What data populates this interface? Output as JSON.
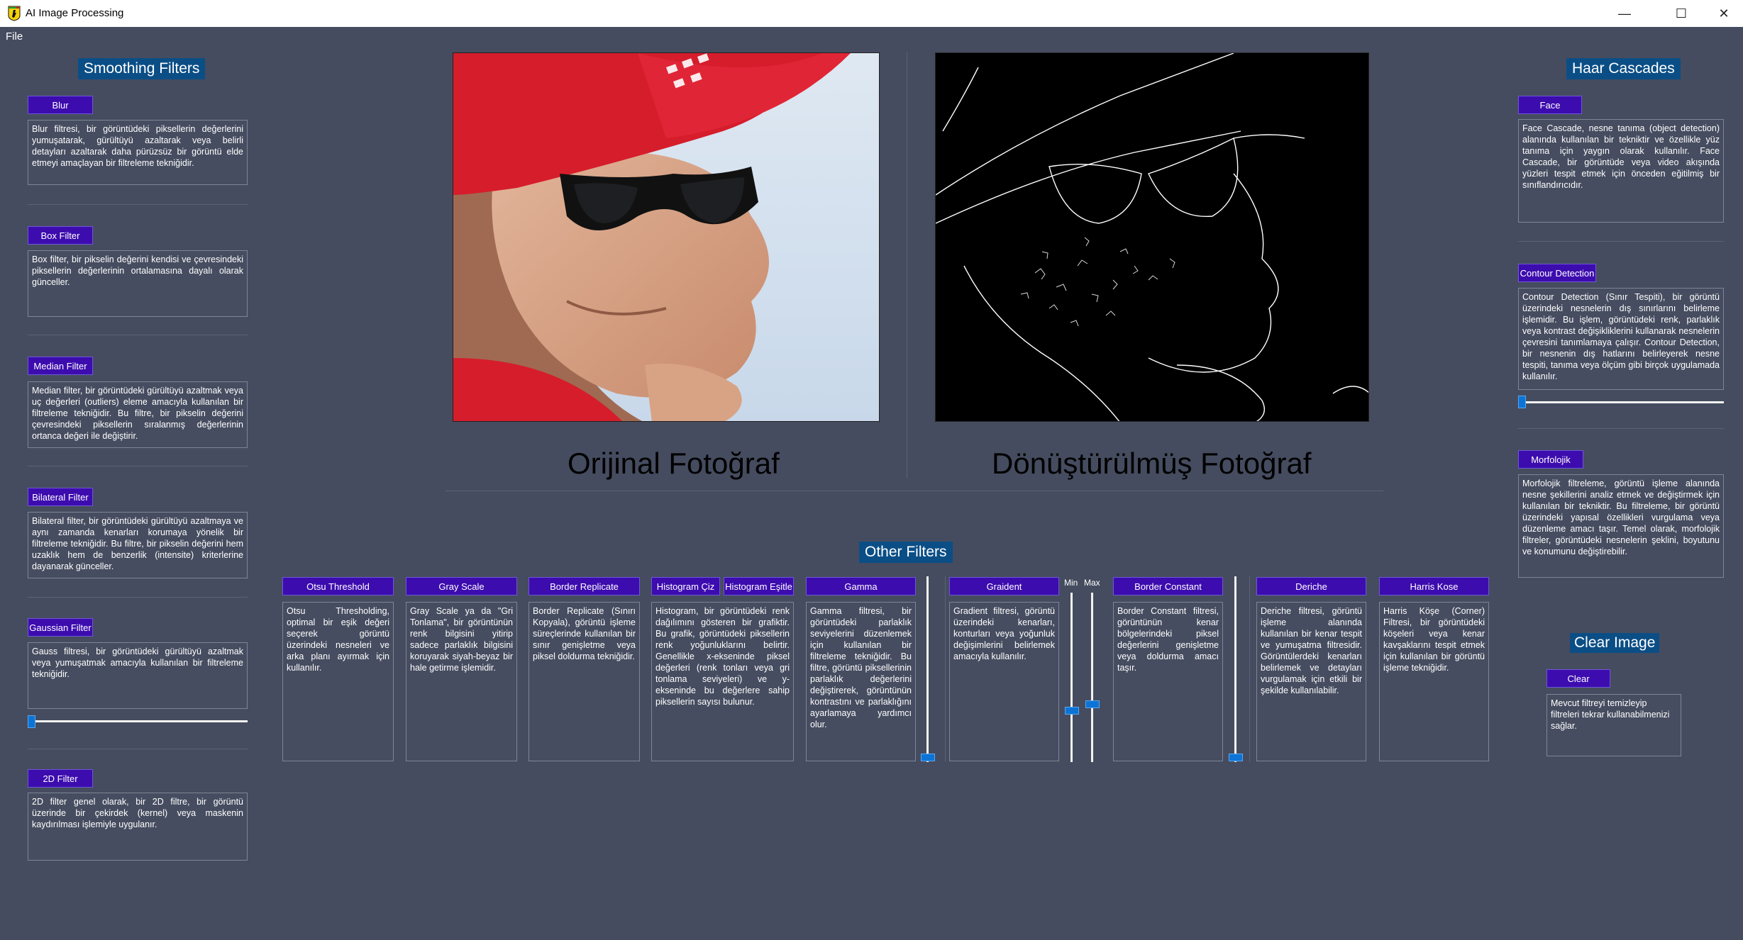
{
  "window": {
    "title": "AI Image Processing",
    "minimize": "—",
    "maximize": "☐",
    "close": "✕"
  },
  "menu": {
    "file": "File"
  },
  "smoothing": {
    "title": "Smoothing Filters",
    "items": [
      {
        "label": "Blur",
        "desc": "Blur filtresi, bir görüntüdeki piksellerin değerlerini yumuşatarak, gürültüyü azaltarak veya belirli detayları azaltarak daha pürüzsüz bir görüntü elde etmeyi amaçlayan bir filtreleme tekniğidir."
      },
      {
        "label": "Box Filter",
        "desc": "Box filter, bir pikselin değerini kendisi ve çevresindeki piksellerin değerlerinin ortalamasına dayalı olarak günceller."
      },
      {
        "label": "Median Filter",
        "desc": "Median filter, bir görüntüdeki gürültüyü azaltmak veya uç değerleri (outliers) eleme amacıyla kullanılan bir filtreleme tekniğidir. Bu filtre, bir pikselin değerini çevresindeki piksellerin sıralanmış değerlerinin ortanca değeri ile değiştirir."
      },
      {
        "label": "Bilateral Filter",
        "desc": "Bilateral filter, bir görüntüdeki gürültüyü azaltmaya ve aynı zamanda kenarları korumaya yönelik bir filtreleme tekniğidir. Bu filtre, bir pikselin değerini hem uzaklık hem de benzerlik (intensite) kriterlerine dayanarak günceller."
      },
      {
        "label": "Gaussian Filter",
        "desc": "Gauss filtresi, bir görüntüdeki gürültüyü azaltmak veya yumuşatmak amacıyla kullanılan bir filtreleme tekniğidir."
      },
      {
        "label": "2D Filter",
        "desc": "2D filter genel olarak, bir 2D filtre, bir görüntü üzerinde bir çekirdek (kernel) veya maskenin kaydırılması işlemiyle uygulanır."
      }
    ]
  },
  "images": {
    "original_caption": "Orijinal Fotoğraf",
    "converted_caption": "Dönüştürülmüş Fotoğraf"
  },
  "other": {
    "title": "Other Filters",
    "otsu": {
      "label": "Otsu Threshold",
      "desc": "Otsu Thresholding, optimal bir eşik değeri seçerek görüntü üzerindeki nesneleri ve arka planı ayırmak için kullanılır."
    },
    "gray": {
      "label": "Gray Scale",
      "desc": "Gray Scale ya da \"Gri Tonlama\", bir görüntünün renk bilgisini yitirip sadece parlaklık bilgisini koruyarak siyah-beyaz bir hale getirme işlemidir."
    },
    "border_replicate": {
      "label": "Border Replicate",
      "desc": "Border Replicate (Sınırı Kopyala), görüntü işleme süreçlerinde kullanılan bir sınır genişletme veya piksel doldurma tekniğidir."
    },
    "histogram": {
      "label_draw": "Histogram Çiz",
      "label_eq": "Histogram Eşitle",
      "desc": "Histogram, bir görüntüdeki renk dağılımını gösteren bir grafiktir. Bu grafik, görüntüdeki piksellerin renk yoğunluklarını belirtir. Genellikle x-ekseninde piksel değerleri (renk tonları veya gri tonlama seviyeleri) ve y-ekseninde bu değerlere sahip piksellerin sayısı bulunur."
    },
    "gamma": {
      "label": "Gamma",
      "desc": "Gamma filtresi, bir görüntüdeki parlaklık seviyelerini düzenlemek için kullanılan bir filtreleme tekniğidir. Bu filtre, görüntü piksellerinin parlaklık değerlerini değiştirerek, görüntünün kontrastını ve parlaklığını ayarlamaya yardımcı olur.",
      "slider_value": 0
    },
    "gradient": {
      "label": "Graident",
      "desc": "Gradient filtresi, görüntü üzerindeki kenarları, konturları veya yoğunluk değişimlerini belirlemek amacıyla kullanılır.",
      "min_label": "Min",
      "max_label": "Max",
      "min_value": 0.3,
      "max_value": 0.35
    },
    "border_constant": {
      "label": "Border Constant",
      "desc": "Border Constant filtresi, görüntünün kenar bölgelerindeki piksel değerlerini genişletme veya doldurma amacı taşır.",
      "slider_value": 0
    },
    "deriche": {
      "label": "Deriche",
      "desc": "Deriche filtresi, görüntü işleme alanında kullanılan bir kenar tespit ve yumuşatma filtresidir. Görüntülerdeki kenarları belirlemek ve detayları vurgulamak için etkili bir şekilde kullanılabilir."
    },
    "harris": {
      "label": "Harris Kose",
      "desc": "Harris Köşe (Corner) Filtresi, bir görüntüdeki köşeleri veya kenar kavşaklarını tespit etmek için kullanılan bir görüntü işleme tekniğidir."
    }
  },
  "haar": {
    "title": "Haar Cascades",
    "face": {
      "label": "Face",
      "desc": "Face Cascade, nesne tanıma (object detection) alanında kullanılan bir tekniktir ve özellikle yüz tanıma için yaygın olarak kullanılır. Face Cascade, bir görüntüde veya video akışında yüzleri tespit etmek için önceden eğitilmiş bir sınıflandırıcıdır."
    },
    "contour": {
      "label": "Contour Detection",
      "desc": "Contour Detection (Sınır Tespiti), bir görüntü üzerindeki nesnelerin dış sınırlarını belirleme işlemidir. Bu işlem, görüntüdeki renk, parlaklık veya kontrast değişikliklerini kullanarak nesnelerin çevresini tanımlamaya çalışır. Contour Detection, bir nesnenin dış hatlarını belirleyerek nesne tespiti, tanıma veya ölçüm gibi birçok uygulamada kullanılır.",
      "slider_value": 0
    },
    "morph": {
      "label": "Morfolojik",
      "desc": "Morfolojik filtreleme, görüntü işleme alanında nesne şekillerini analiz etmek ve değiştirmek için kullanılan bir tekniktir. Bu filtreleme, bir görüntü üzerindeki yapısal özellikleri vurgulama veya düzenleme amacı taşır. Temel olarak, morfolojik filtreler, görüntüdeki nesnelerin şeklini, boyutunu ve konumunu değiştirebilir."
    }
  },
  "clear": {
    "title": "Clear Image",
    "label": "Clear",
    "desc": "Mevcut filtreyi temizleyip filtreleri tekrar kullanabilmenizi sağlar."
  },
  "colors": {
    "background": "#454c5f",
    "button": "#3d0cae",
    "section_title": "#0b4e86",
    "slider": "#0d74d6"
  }
}
